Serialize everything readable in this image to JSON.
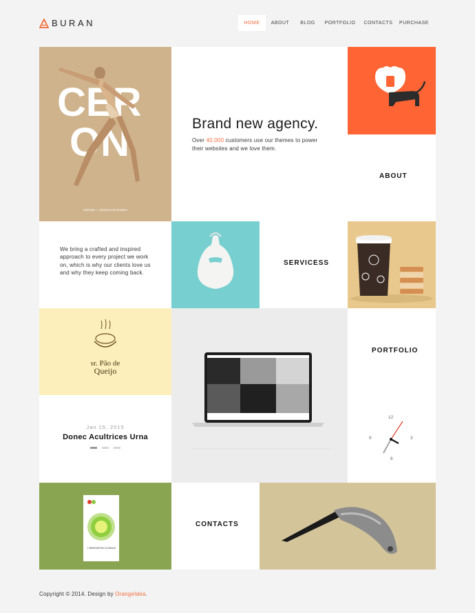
{
  "header": {
    "brand": "BURAN",
    "nav": [
      {
        "label": "HOME",
        "active": true
      },
      {
        "label": "ABOUT",
        "active": false
      },
      {
        "label": "BLOG",
        "active": false
      },
      {
        "label": "PORTFOLIO",
        "active": false
      },
      {
        "label": "CONTACTS",
        "active": false
      },
      {
        "label": "PURCHASE",
        "active": false
      }
    ]
  },
  "hero": {
    "title": "Brand new agency.",
    "subtitle_prefix": "Over ",
    "subtitle_highlight": "40,000",
    "subtitle_suffix": " customers use our themes to power their websites and we love them.",
    "poster_letters": [
      "CER",
      "ON"
    ],
    "poster_caption": "CEROM — SCUOLA DI DANZA"
  },
  "sections": {
    "about": "ABOUT",
    "services": "SERVICESS",
    "portfolio": "PORTFOLIO",
    "contacts": "CONTACTS"
  },
  "intro_text": "We bring a crafted and inspired approach to every project we work on, which is why our clients love us and why they keep coming back.",
  "queijo": {
    "line1": "sr. Pão de",
    "line2": "Queijo"
  },
  "book": {
    "title": "L'INNOVATION GLOBALE"
  },
  "blog_post": {
    "date": "Jan 15, 2015",
    "title": "Donec Acultrices Urna"
  },
  "clock": {
    "n12": "12",
    "n3": "3",
    "n6": "6",
    "n9": "9"
  },
  "footer": {
    "text": "Copyright © 2014. Design by ",
    "link": "OrangeIdea",
    "end": "."
  },
  "colors": {
    "accent": "#f26b3a",
    "orange_tile": "#ff6534",
    "tan": "#cfb38c",
    "teal": "#78cfcf",
    "sand": "#e8c88c",
    "cream": "#fcefbb",
    "green": "#8aa552",
    "khaki": "#d4c49a"
  }
}
